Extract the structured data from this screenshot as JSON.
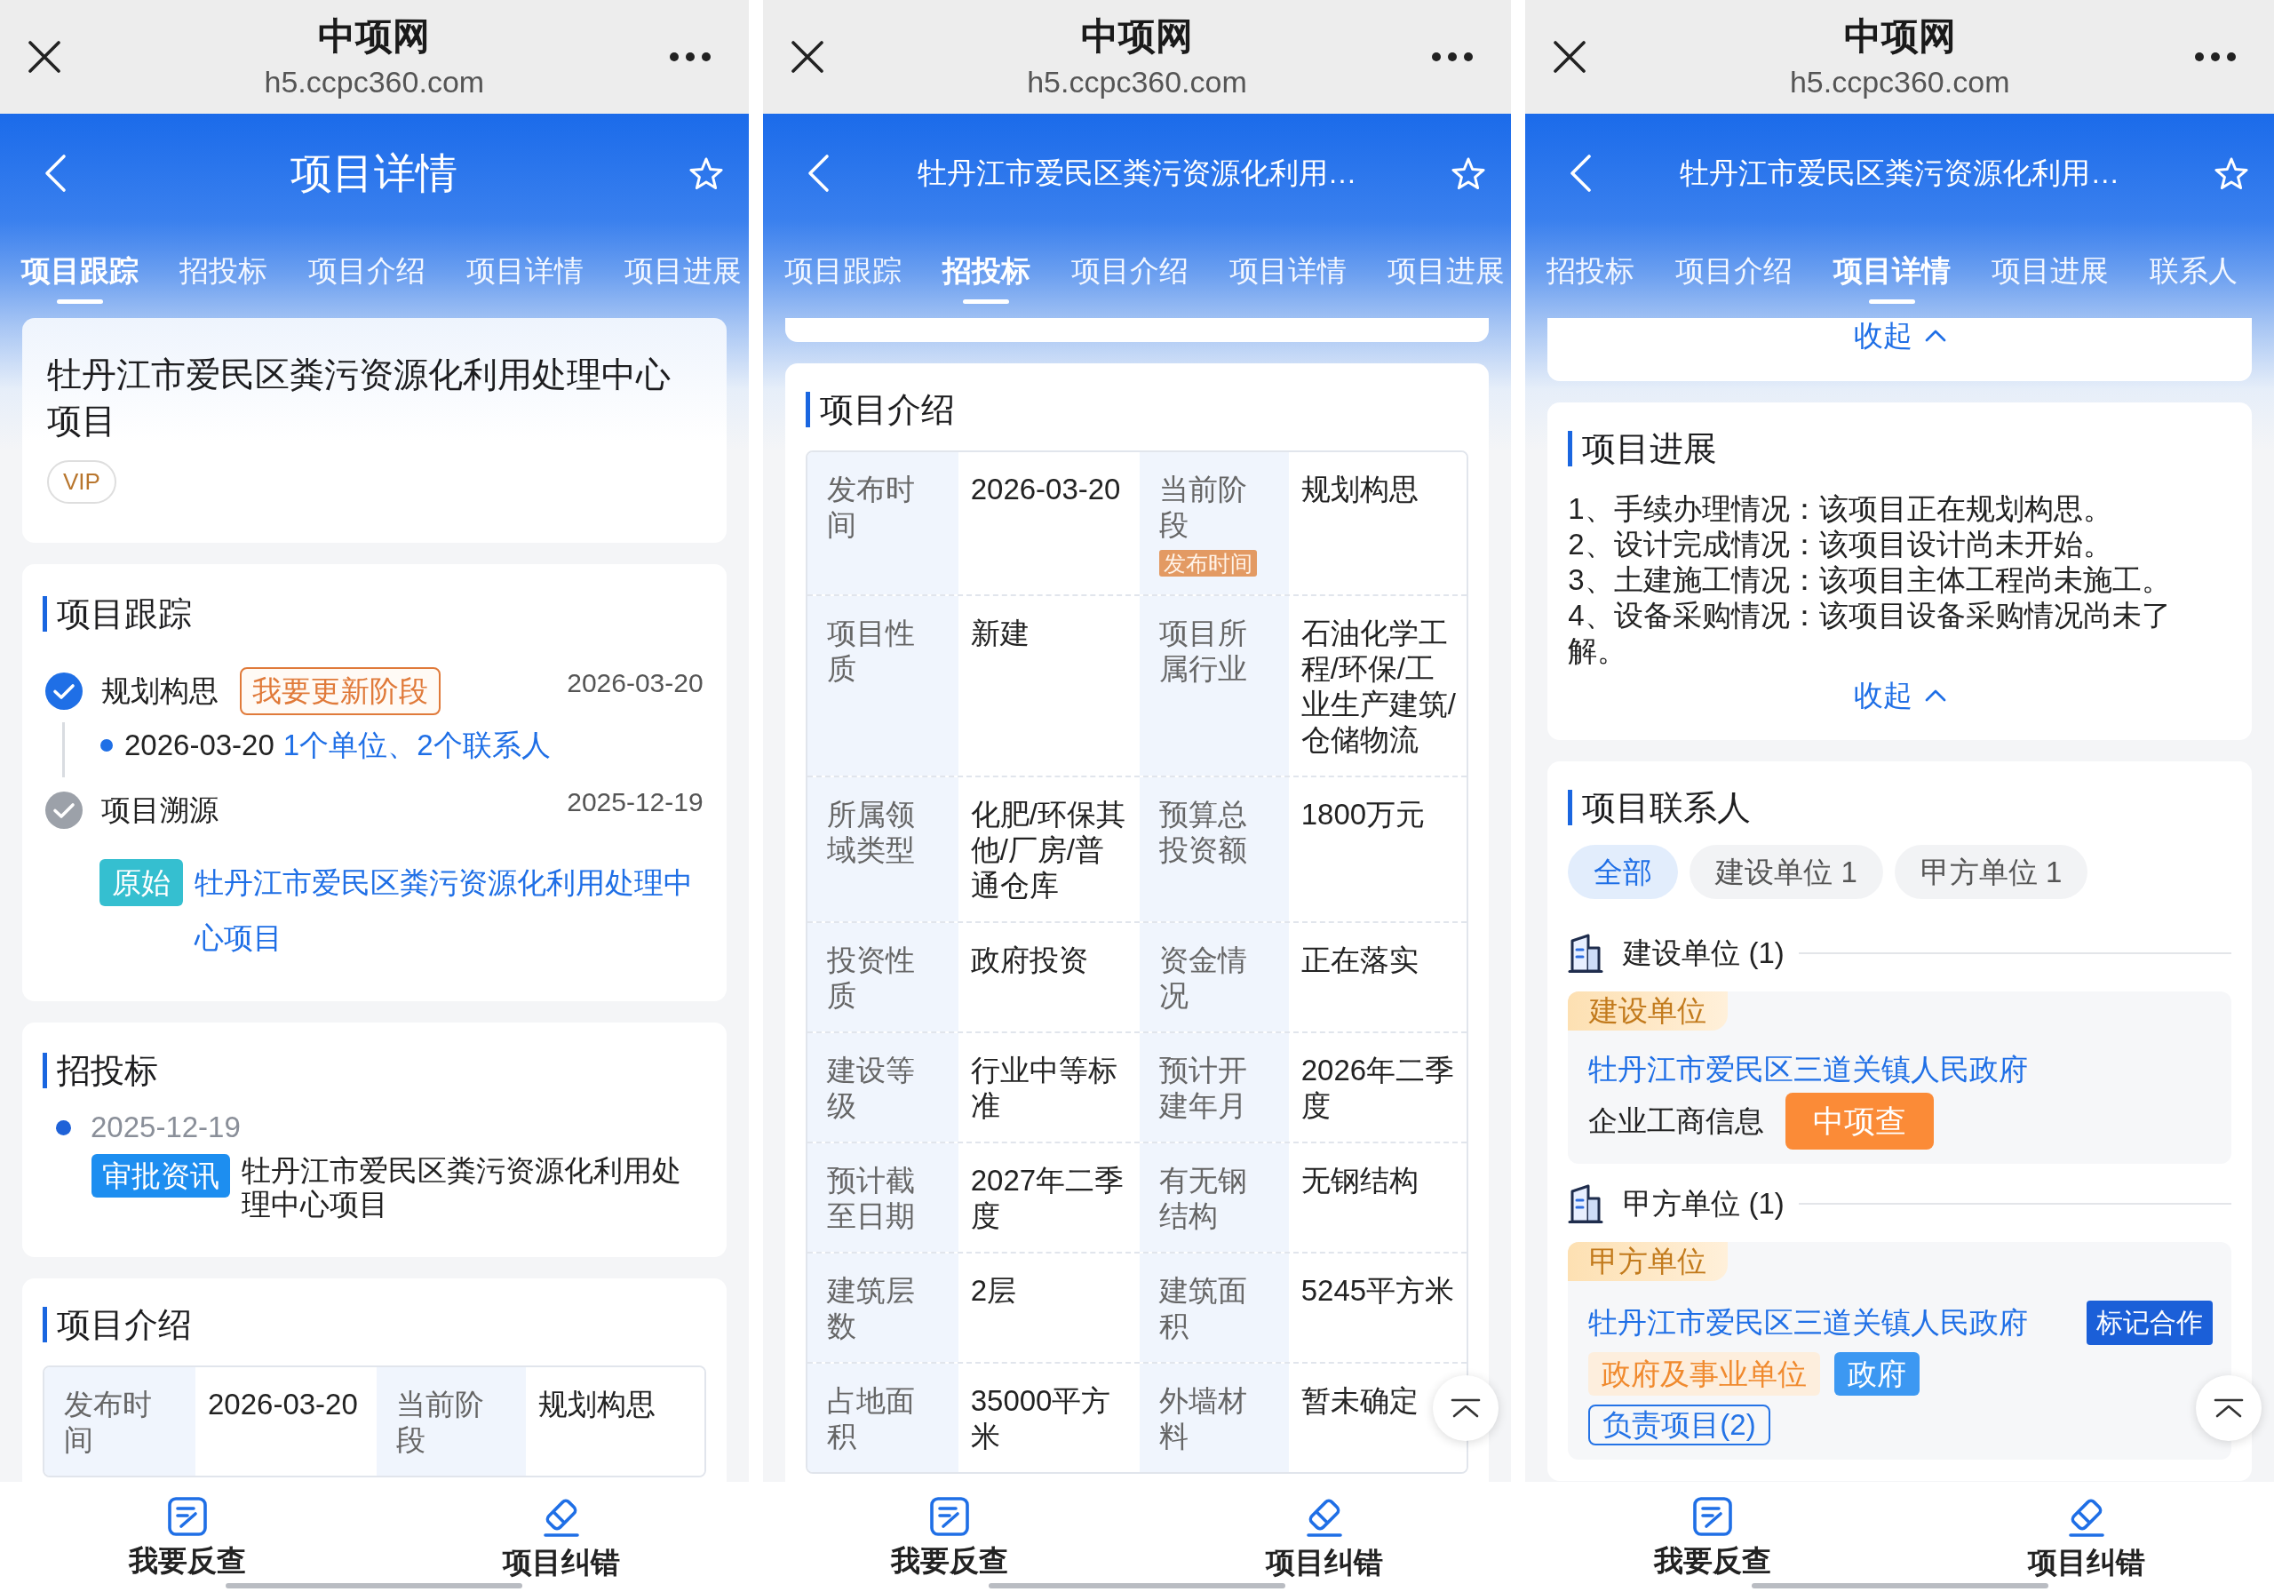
{
  "screens": [
    {
      "browser": {
        "title": "中项网",
        "url": "h5.ccpc360.com"
      },
      "header": {
        "kind": "page_title",
        "title": "项目详情"
      },
      "tabs": [
        {
          "label": "项目跟踪",
          "selected": true
        },
        {
          "label": "招投标",
          "selected": false
        },
        {
          "label": "项目介绍",
          "selected": false
        },
        {
          "label": "项目详情",
          "selected": false
        },
        {
          "label": "项目进展",
          "selected": false
        }
      ],
      "sections": [
        {
          "kind": "summary",
          "title": "牡丹江市爱民区粪污资源化利用处理中心项目",
          "badge": "VIP"
        },
        {
          "kind": "tracking",
          "title": "项目跟踪",
          "entries": [
            {
              "active": true,
              "label": "规划构思",
              "action": "我要更新阶段",
              "date": "2026-03-20",
              "detail": {
                "date": "2026-03-20",
                "link": "1个单位、2个联系人"
              }
            },
            {
              "active": false,
              "label": "项目溯源",
              "date": "2025-12-19",
              "source": {
                "tag": "原始",
                "link": "牡丹江市爱民区粪污资源化利用处理中心项目"
              }
            }
          ]
        },
        {
          "kind": "bidding",
          "title": "招投标",
          "items": [
            {
              "date": "2025-12-19",
              "tag": "审批资讯",
              "text": "牡丹江市爱民区粪污资源化利用处理中心项目"
            }
          ]
        },
        {
          "kind": "intro",
          "title": "项目介绍",
          "rows": [
            [
              {
                "label": "发布时间",
                "value": "2026-03-20"
              },
              {
                "label": "当前阶段",
                "value": "规划构思"
              }
            ]
          ]
        }
      ],
      "bottom_bar": [
        {
          "kind": "report",
          "label": "我要反查"
        },
        {
          "kind": "correction",
          "label": "项目纠错"
        }
      ]
    },
    {
      "browser": {
        "title": "中项网",
        "url": "h5.ccpc360.com"
      },
      "header": {
        "kind": "project_name",
        "title": "牡丹江市爱民区粪污资源化利用…"
      },
      "tabs": [
        {
          "label": "项目跟踪",
          "selected": false
        },
        {
          "label": "招投标",
          "selected": true
        },
        {
          "label": "项目介绍",
          "selected": false
        },
        {
          "label": "项目详情",
          "selected": false
        },
        {
          "label": "项目进展",
          "selected": false
        }
      ],
      "sections": [
        {
          "kind": "card_end"
        },
        {
          "kind": "intro",
          "title": "项目介绍",
          "rows": [
            [
              {
                "label": "发布时间",
                "value": "2026-03-20"
              },
              {
                "label": "当前阶段",
                "tag": "发布时间",
                "value": "规划构思"
              }
            ],
            [
              {
                "label": "项目性质",
                "value": "新建"
              },
              {
                "label": "项目所属行业",
                "value": "石油化学工程/环保/工业生产建筑/仓储物流"
              }
            ],
            [
              {
                "label": "所属领域类型",
                "value": "化肥/环保其他/厂房/普通仓库"
              },
              {
                "label": "预算总投资额",
                "value": "1800万元"
              }
            ],
            [
              {
                "label": "投资性质",
                "value": "政府投资"
              },
              {
                "label": "资金情况",
                "value": "正在落实"
              }
            ],
            [
              {
                "label": "建设等级",
                "value": "行业中等标准"
              },
              {
                "label": "预计开建年月",
                "value": "2026年二季度"
              }
            ],
            [
              {
                "label": "预计截至日期",
                "value": "2027年二季度"
              },
              {
                "label": "有无钢结构",
                "value": "无钢结构"
              }
            ],
            [
              {
                "label": "建筑层数",
                "value": "2层"
              },
              {
                "label": "建筑面积",
                "value": "5245平方米"
              }
            ],
            [
              {
                "label": "占地面积",
                "value": "35000平方米"
              },
              {
                "label": "外墙材料",
                "value": "暂未确定"
              }
            ]
          ]
        }
      ],
      "scroll_top": true,
      "bottom_bar": [
        {
          "kind": "report",
          "label": "我要反查"
        },
        {
          "kind": "correction",
          "label": "项目纠错"
        }
      ]
    },
    {
      "browser": {
        "title": "中项网",
        "url": "h5.ccpc360.com"
      },
      "header": {
        "kind": "project_name",
        "title": "牡丹江市爱民区粪污资源化利用…"
      },
      "tabs": [
        {
          "label": "招投标",
          "selected": false
        },
        {
          "label": "项目介绍",
          "selected": false
        },
        {
          "label": "项目详情",
          "selected": true
        },
        {
          "label": "项目进展",
          "selected": false
        },
        {
          "label": "联系人",
          "selected": false
        }
      ],
      "sections": [
        {
          "kind": "collapse_end",
          "toggle": "收起"
        },
        {
          "kind": "progress",
          "title": "项目进展",
          "lines": [
            "1、手续办理情况：该项目正在规划构思。",
            "2、设计完成情况：该项目设计尚未开始。",
            "3、土建施工情况：该项目主体工程尚未施工。",
            "4、设备采购情况：该项目设备采购情况尚未了解。"
          ],
          "toggle": "收起"
        },
        {
          "kind": "contacts",
          "title": "项目联系人",
          "filters": [
            {
              "label": "全部",
              "selected": true
            },
            {
              "label": "建设单位 1",
              "selected": false
            },
            {
              "label": "甲方单位 1",
              "selected": false
            }
          ],
          "groups": [
            {
              "title": "建设单位 (1)",
              "role": "建设单位",
              "company": "牡丹江市爱民区三道关镇人民政府",
              "info": {
                "label": "企业工商信息",
                "button": "中项查"
              }
            },
            {
              "title": "甲方单位 (1)",
              "role": "甲方单位",
              "company": "牡丹江市爱民区三道关镇人民政府",
              "mark_button": "标记合作",
              "tags": [
                {
                  "kind": "category",
                  "label": "政府及事业单位"
                },
                {
                  "kind": "type",
                  "label": "政府"
                }
              ],
              "projects_button": "负责项目(2)"
            }
          ]
        }
      ],
      "scroll_top": true,
      "bottom_bar": [
        {
          "kind": "report",
          "label": "我要反查"
        },
        {
          "kind": "correction",
          "label": "项目纠错"
        }
      ]
    }
  ]
}
